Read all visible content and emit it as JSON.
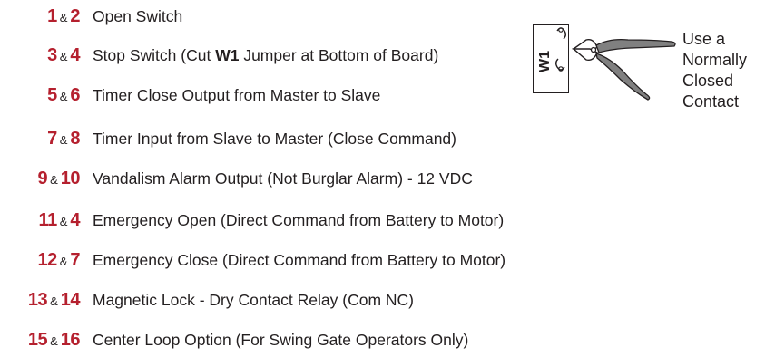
{
  "rows": [
    {
      "a": "1",
      "amp": "&",
      "b": "2",
      "pre": "Open Switch",
      "bold": "",
      "post": ""
    },
    {
      "a": "3",
      "amp": "&",
      "b": "4",
      "pre": "Stop Switch (Cut ",
      "bold": "W1",
      "post": " Jumper at Bottom of Board)"
    },
    {
      "a": "5",
      "amp": "&",
      "b": "6",
      "pre": "Timer Close Output from Master to Slave",
      "bold": "",
      "post": ""
    },
    {
      "a": "7",
      "amp": "&",
      "b": "8",
      "pre": "Timer Input from Slave to Master (Close Command)",
      "bold": "",
      "post": ""
    },
    {
      "a": "9",
      "amp": "&",
      "b": "10",
      "pre": "Vandalism Alarm Output (Not Burglar Alarm) - 12 VDC",
      "bold": "",
      "post": ""
    },
    {
      "a": "11",
      "amp": "&",
      "b": "4",
      "pre": "Emergency Open (Direct Command from Battery to Motor)",
      "bold": "",
      "post": ""
    },
    {
      "a": "12",
      "amp": "&",
      "b": "7",
      "pre": "Emergency Close (Direct Command from Battery to Motor)",
      "bold": "",
      "post": ""
    },
    {
      "a": "13",
      "amp": "&",
      "b": "14",
      "pre": "Magnetic Lock - Dry Contact Relay (Com NC)",
      "bold": "",
      "post": ""
    },
    {
      "a": "15",
      "amp": "&",
      "b": "16",
      "pre": "Center Loop Option (For Swing Gate Operators Only)",
      "bold": "",
      "post": ""
    }
  ],
  "jumper": {
    "label": "W1"
  },
  "side_note": {
    "lines": [
      "Use a",
      "Normally",
      "Closed",
      "Contact"
    ]
  },
  "colors": {
    "terminal_number": "#b5202e",
    "text": "#231f20",
    "cutter_handle": "#808080"
  },
  "icons": {
    "cutter": "wire-cutter-icon",
    "jumper": "jumper-icon"
  }
}
